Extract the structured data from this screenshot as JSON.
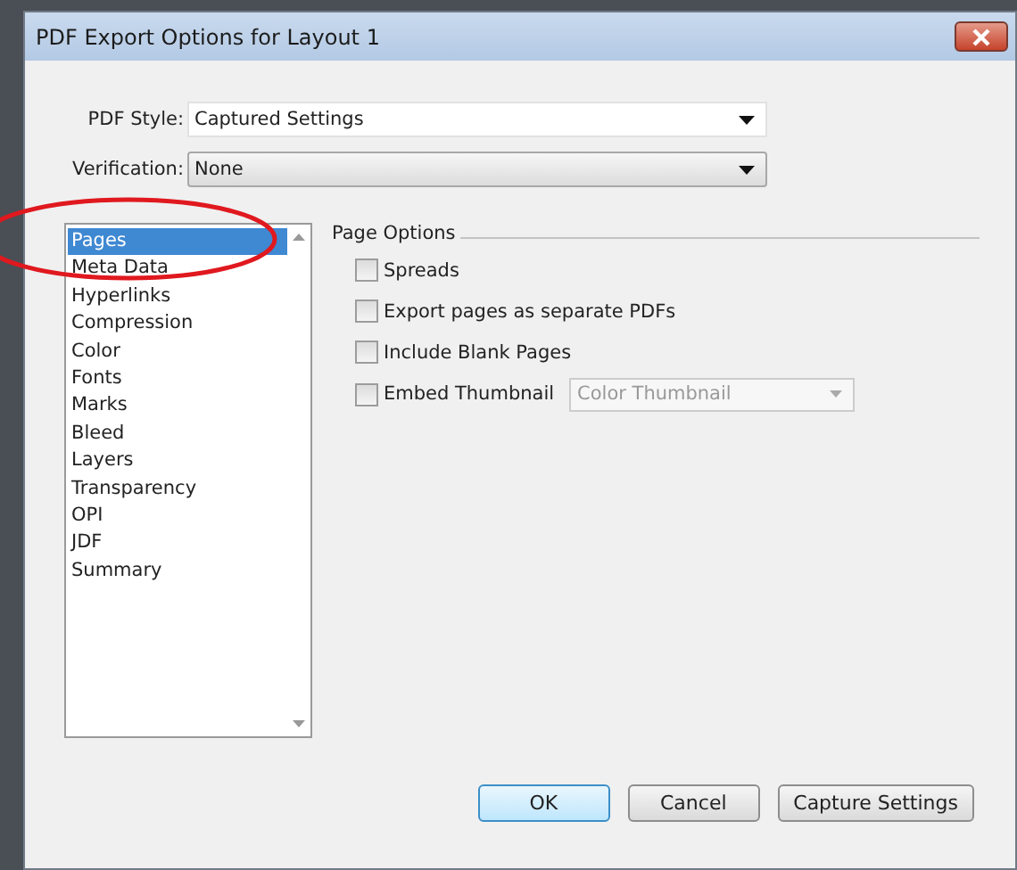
{
  "window": {
    "title": "PDF Export Options for Layout 1"
  },
  "pdf_style": {
    "label": "PDF Style:",
    "value": "Captured Settings"
  },
  "verification": {
    "label": "Verification:",
    "value": "None"
  },
  "sidebar": {
    "items": [
      {
        "label": "Pages",
        "selected": true
      },
      {
        "label": "Meta Data",
        "selected": false
      },
      {
        "label": "Hyperlinks",
        "selected": false
      },
      {
        "label": "Compression",
        "selected": false
      },
      {
        "label": "Color",
        "selected": false
      },
      {
        "label": "Fonts",
        "selected": false
      },
      {
        "label": "Marks",
        "selected": false
      },
      {
        "label": "Bleed",
        "selected": false
      },
      {
        "label": "Layers",
        "selected": false
      },
      {
        "label": "Transparency",
        "selected": false
      },
      {
        "label": "OPI",
        "selected": false
      },
      {
        "label": "JDF",
        "selected": false
      },
      {
        "label": "Summary",
        "selected": false
      }
    ]
  },
  "page_options": {
    "title": "Page Options",
    "options": [
      {
        "label": "Spreads",
        "checked": false
      },
      {
        "label": "Export pages as separate PDFs",
        "checked": false
      },
      {
        "label": "Include Blank Pages",
        "checked": false
      },
      {
        "label": "Embed Thumbnail",
        "checked": false,
        "dropdown": {
          "value": "Color Thumbnail",
          "disabled": true
        }
      }
    ]
  },
  "buttons": [
    {
      "label": "OK",
      "default": true
    },
    {
      "label": "Cancel",
      "default": false
    },
    {
      "label": "Capture Settings",
      "default": false
    }
  ]
}
